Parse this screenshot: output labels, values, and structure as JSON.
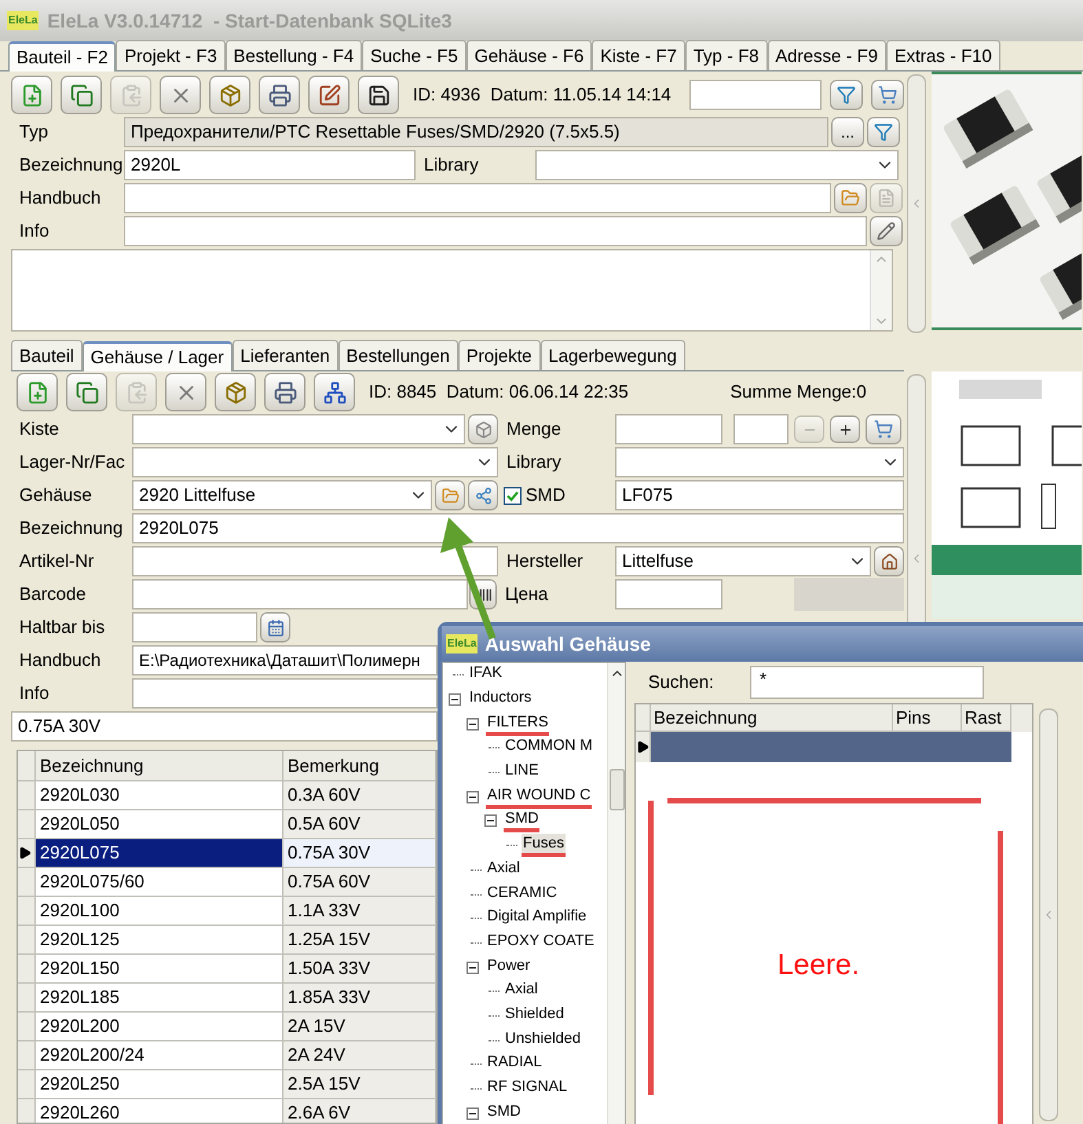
{
  "window": {
    "logo": "EleLa",
    "title": "EleLa V3.0.14712  - Start-Datenbank SQLite3"
  },
  "tabs": [
    {
      "label": "Bauteil - F2",
      "selected": true
    },
    {
      "label": "Projekt - F3",
      "selected": false
    },
    {
      "label": "Bestellung - F4",
      "selected": false
    },
    {
      "label": "Suche - F5",
      "selected": false
    },
    {
      "label": "Gehäuse - F6",
      "selected": false
    },
    {
      "label": "Kiste - F7",
      "selected": false
    },
    {
      "label": "Typ - F8",
      "selected": false
    },
    {
      "label": "Adresse - F9",
      "selected": false
    },
    {
      "label": "Extras - F10",
      "selected": false
    }
  ],
  "part": {
    "toolbar": [
      {
        "kind": "new",
        "disabled": false
      },
      {
        "kind": "copy",
        "disabled": false
      },
      {
        "kind": "paste",
        "disabled": true
      },
      {
        "kind": "delete",
        "disabled": false
      },
      {
        "kind": "archive",
        "disabled": false
      },
      {
        "kind": "print",
        "disabled": false
      },
      {
        "kind": "edit",
        "disabled": false
      },
      {
        "kind": "export",
        "disabled": false
      }
    ],
    "record": "ID: 4936  Datum: 11.05.14 14:14",
    "type": {
      "label": "Typ",
      "value": "Предохранители/PTC Resettable Fuses/SMD/2920 (7.5x5.5)",
      "browse": "..."
    },
    "name": {
      "label": "Bezeichnung",
      "value": "2920L"
    },
    "library": {
      "label": "Library"
    },
    "manual": {
      "label": "Handbuch"
    },
    "info": {
      "label": "Info"
    }
  },
  "subtabs": [
    {
      "label": "Bauteil",
      "selected": false
    },
    {
      "label": "Gehäuse / Lager",
      "selected": true
    },
    {
      "label": "Lieferanten",
      "selected": false
    },
    {
      "label": "Bestellungen",
      "selected": false
    },
    {
      "label": "Projekte",
      "selected": false
    },
    {
      "label": "Lagerbewegung",
      "selected": false
    }
  ],
  "stock": {
    "toolbar": [
      {
        "kind": "new",
        "disabled": false
      },
      {
        "kind": "copy",
        "disabled": false
      },
      {
        "kind": "paste",
        "disabled": true
      },
      {
        "kind": "delete",
        "disabled": false
      },
      {
        "kind": "archive",
        "disabled": false
      },
      {
        "kind": "print",
        "disabled": false
      },
      {
        "kind": "network",
        "disabled": false
      }
    ],
    "record": "ID: 8845  Datum: 06.06.14 22:35",
    "total": "Summe Menge:0",
    "box": {
      "label": "Kiste"
    },
    "quantity": {
      "label": "Menge"
    },
    "location": {
      "label": "Lager-Nr/Fac"
    },
    "library": {
      "label": "Library"
    },
    "package": {
      "label": "Gehäuse",
      "value": "2920 Littelfuse"
    },
    "smd": {
      "label": "SMD",
      "checked": true,
      "value": "LF075"
    },
    "name": {
      "label": "Bezeichnung",
      "value": "2920L075"
    },
    "article": {
      "label": "Artikel-Nr"
    },
    "maker": {
      "label": "Hersteller",
      "value": "Littelfuse"
    },
    "barcode": {
      "label": "Barcode"
    },
    "price": {
      "label": "Цена"
    },
    "expiry": {
      "label": "Haltbar bis"
    },
    "manual": {
      "label": "Handbuch",
      "value": "E:\\Радиотехника\\Даташит\\Полимерн"
    },
    "info": {
      "label": "Info"
    },
    "memo": "0.75A 30V",
    "table": {
      "columns": [
        "Bezeichnung",
        "Bemerkung"
      ],
      "rows": [
        {
          "cells": [
            "2920L030",
            "0.3A 60V"
          ],
          "selected": false
        },
        {
          "cells": [
            "2920L050",
            "0.5A 60V"
          ],
          "selected": false
        },
        {
          "cells": [
            "2920L075",
            "0.75A 30V"
          ],
          "selected": true
        },
        {
          "cells": [
            "2920L075/60",
            "0.75A 60V"
          ],
          "selected": false
        },
        {
          "cells": [
            "2920L100",
            "1.1A 33V"
          ],
          "selected": false
        },
        {
          "cells": [
            "2920L125",
            "1.25A 15V"
          ],
          "selected": false
        },
        {
          "cells": [
            "2920L150",
            "1.50A 33V"
          ],
          "selected": false
        },
        {
          "cells": [
            "2920L185",
            "1.85A 33V"
          ],
          "selected": false
        },
        {
          "cells": [
            "2920L200",
            "2A 15V"
          ],
          "selected": false
        },
        {
          "cells": [
            "2920L200/24",
            "2A 24V"
          ],
          "selected": false
        },
        {
          "cells": [
            "2920L250",
            "2.5A 15V"
          ],
          "selected": false
        },
        {
          "cells": [
            "2920L260",
            "2.6A 6V"
          ],
          "selected": false
        }
      ]
    }
  },
  "dialog": {
    "logo": "EleLa",
    "title": "Auswahl Gehäuse",
    "tree": [
      {
        "label": "IFAK",
        "expanded": false,
        "selected": false,
        "marked": false
      },
      {
        "label": "Inductors",
        "expanded": true,
        "selected": false,
        "marked": false,
        "children": [
          {
            "label": "FILTERS",
            "expanded": true,
            "selected": false,
            "marked": true,
            "children": [
              {
                "label": "COMMON M",
                "expanded": false,
                "selected": false,
                "marked": false
              },
              {
                "label": "LINE",
                "expanded": false,
                "selected": false,
                "marked": false
              }
            ]
          },
          {
            "label": "AIR WOUND C",
            "expanded": true,
            "selected": false,
            "marked": true,
            "children": [
              {
                "label": "SMD",
                "expanded": true,
                "selected": false,
                "marked": true,
                "children": [
                  {
                    "label": "Fuses",
                    "expanded": false,
                    "selected": true,
                    "marked": true
                  }
                ]
              }
            ]
          },
          {
            "label": "Axial",
            "expanded": false,
            "selected": false,
            "marked": false
          },
          {
            "label": "CERAMIC",
            "expanded": false,
            "selected": false,
            "marked": false
          },
          {
            "label": "Digital Amplifie",
            "expanded": false,
            "selected": false,
            "marked": false
          },
          {
            "label": "EPOXY COATE",
            "expanded": false,
            "selected": false,
            "marked": false
          },
          {
            "label": "Power",
            "expanded": true,
            "selected": false,
            "marked": false,
            "children": [
              {
                "label": "Axial",
                "expanded": false,
                "selected": false,
                "marked": false
              },
              {
                "label": "Shielded",
                "expanded": false,
                "selected": false,
                "marked": false
              },
              {
                "label": "Unshielded",
                "expanded": false,
                "selected": false,
                "marked": false
              }
            ]
          },
          {
            "label": "RADIAL",
            "expanded": false,
            "selected": false,
            "marked": false
          },
          {
            "label": "RF SIGNAL",
            "expanded": false,
            "selected": false,
            "marked": false
          },
          {
            "label": "SMD",
            "expanded": true,
            "selected": false,
            "marked": false
          }
        ]
      }
    ],
    "search": {
      "label": "Suchen:",
      "value": "*"
    },
    "table": {
      "columns": [
        "Bezeichnung",
        "Pins",
        "Rast"
      ],
      "rows": [
        {
          "selected": true
        }
      ]
    },
    "annotation": "Leere."
  }
}
